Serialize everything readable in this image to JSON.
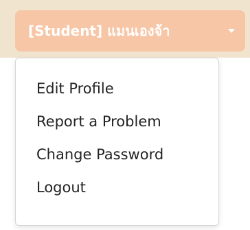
{
  "header": {
    "user_button_label": "[Student] แมนเองจ้า"
  },
  "dropdown": {
    "items": [
      {
        "label": "Edit Profile"
      },
      {
        "label": "Report a Problem"
      },
      {
        "label": "Change Password"
      },
      {
        "label": "Logout"
      }
    ]
  },
  "colors": {
    "topbar_bg": "#f1e4ce",
    "button_bg": "#f7c6a6",
    "button_text": "#ffffff",
    "menu_text": "#222222"
  }
}
